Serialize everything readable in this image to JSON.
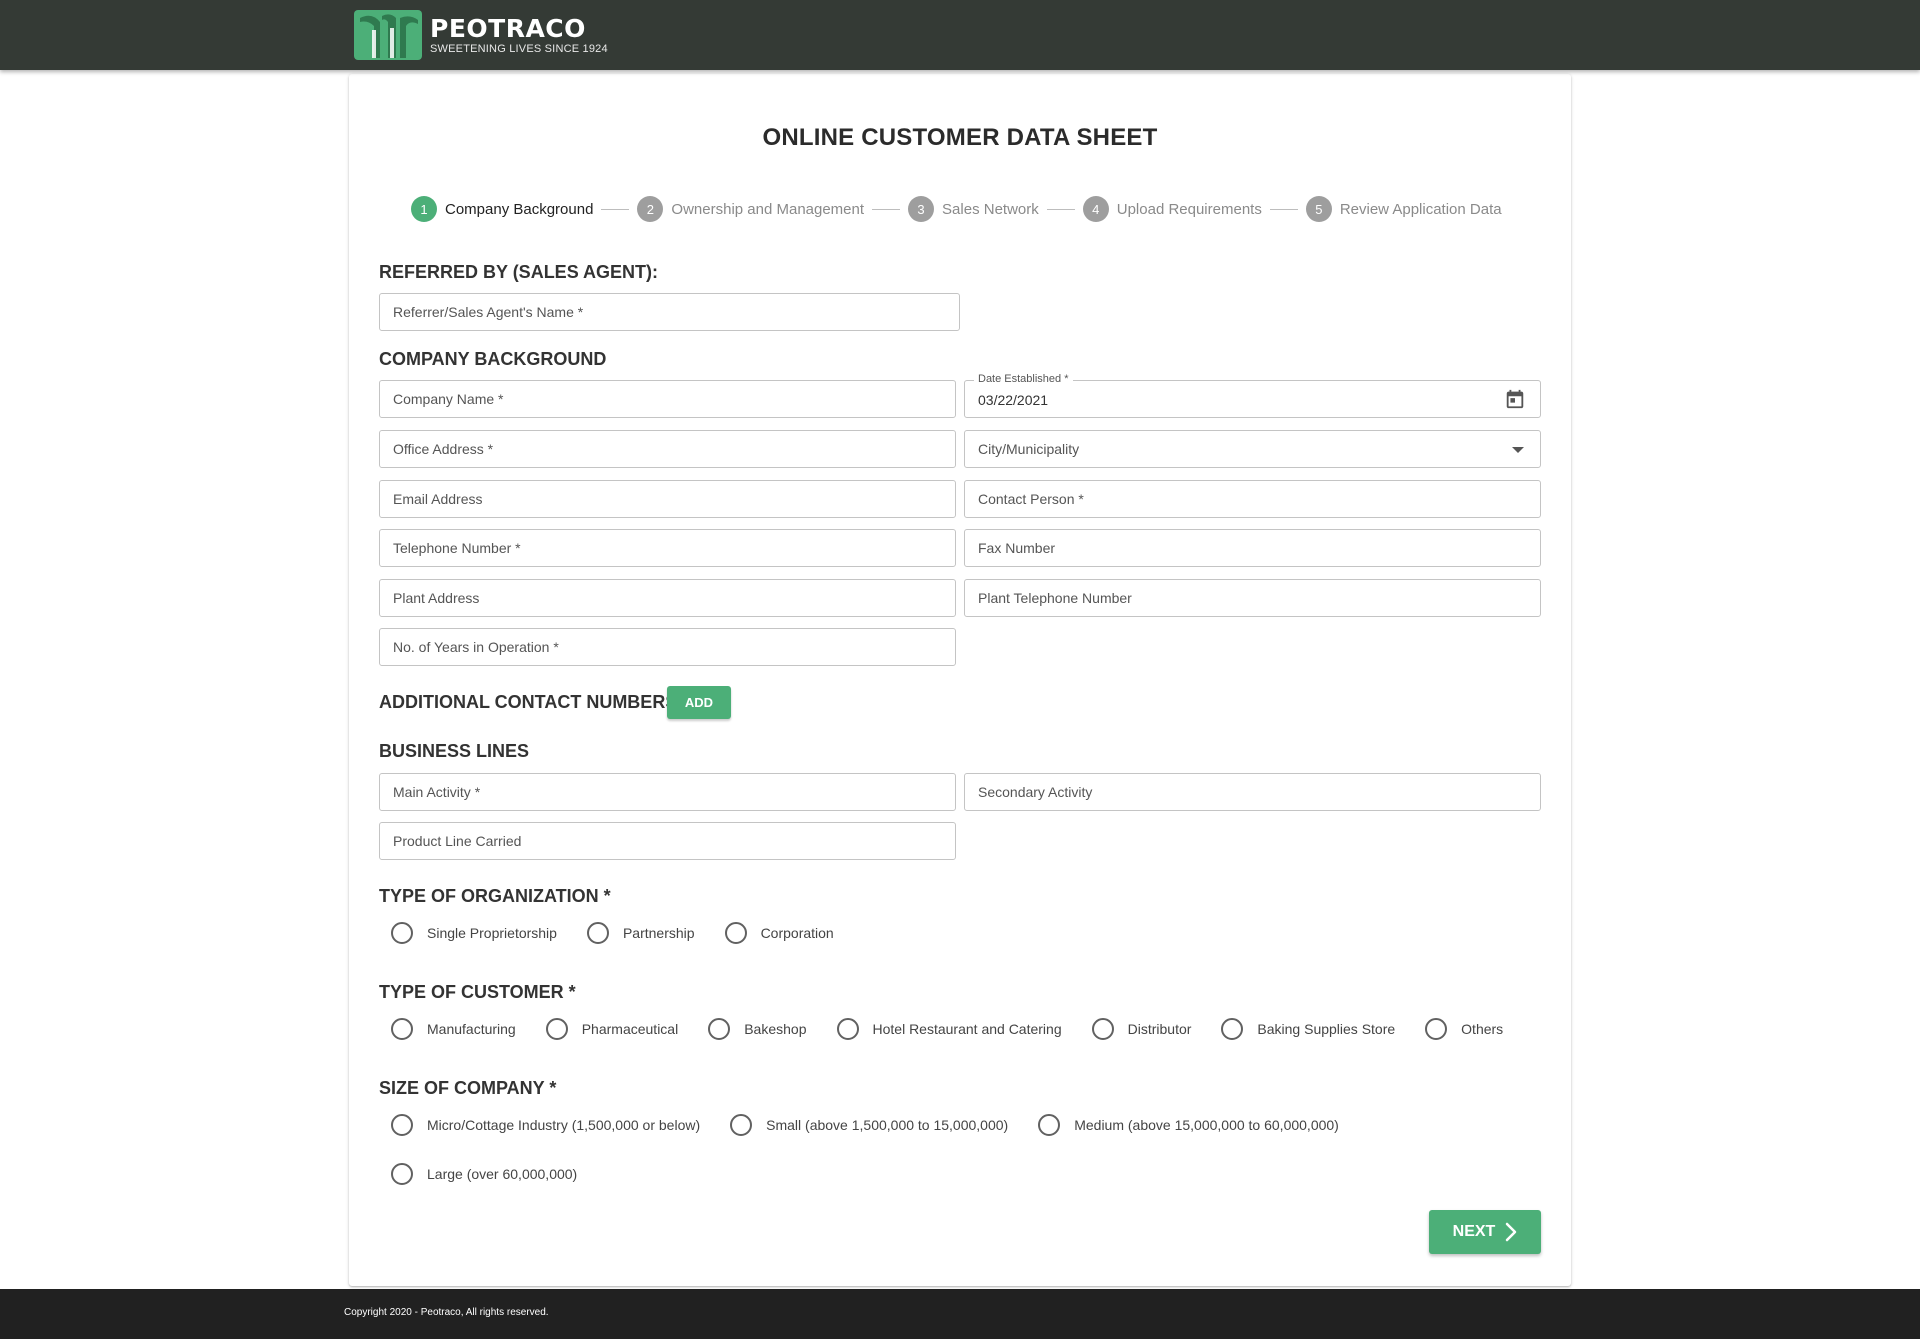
{
  "brand": {
    "name": "PEOTRACO",
    "tagline": "SWEETENING LIVES SINCE 1924",
    "accent": "#4caf78",
    "header_bg": "#343a35"
  },
  "page": {
    "title": "ONLINE CUSTOMER DATA SHEET"
  },
  "stepper": [
    {
      "num": "1",
      "label": "Company Background",
      "active": true
    },
    {
      "num": "2",
      "label": "Ownership and Management",
      "active": false
    },
    {
      "num": "3",
      "label": "Sales Network",
      "active": false
    },
    {
      "num": "4",
      "label": "Upload Requirements",
      "active": false
    },
    {
      "num": "5",
      "label": "Review Application Data",
      "active": false
    }
  ],
  "referred": {
    "heading": "REFERRED BY (SALES AGENT):",
    "agent_placeholder": "Referrer/Sales Agent's Name *"
  },
  "company": {
    "heading": "COMPANY BACKGROUND",
    "company_name": "Company Name *",
    "date_label": "Date Established *",
    "date_value": "03/22/2021",
    "office_address": "Office Address *",
    "city": "City/Municipality",
    "email": "Email Address",
    "contact_person": "Contact Person *",
    "telephone": "Telephone Number *",
    "fax": "Fax Number",
    "plant_address": "Plant Address",
    "plant_telephone": "Plant Telephone Number",
    "years": "No. of Years in Operation *"
  },
  "additional": {
    "heading": "ADDITIONAL CONTACT NUMBERS",
    "add_label": "ADD"
  },
  "business": {
    "heading": "BUSINESS LINES",
    "main_activity": "Main Activity *",
    "secondary_activity": "Secondary Activity",
    "product_line": "Product Line Carried"
  },
  "org_type": {
    "heading": "TYPE OF ORGANIZATION *",
    "options": [
      "Single Proprietorship",
      "Partnership",
      "Corporation"
    ]
  },
  "customer_type": {
    "heading": "TYPE OF CUSTOMER *",
    "options": [
      "Manufacturing",
      "Pharmaceutical",
      "Bakeshop",
      "Hotel Restaurant and Catering",
      "Distributor",
      "Baking Supplies Store",
      "Others"
    ]
  },
  "company_size": {
    "heading": "SIZE OF COMPANY *",
    "options": [
      "Micro/Cottage Industry (1,500,000 or below)",
      "Small (above 1,500,000 to 15,000,000)",
      "Medium (above 15,000,000 to 60,000,000)",
      "Large (over 60,000,000)"
    ]
  },
  "actions": {
    "next_label": "NEXT"
  },
  "footer": {
    "copyright": "Copyright 2020 - Peotraco, All rights reserved."
  }
}
